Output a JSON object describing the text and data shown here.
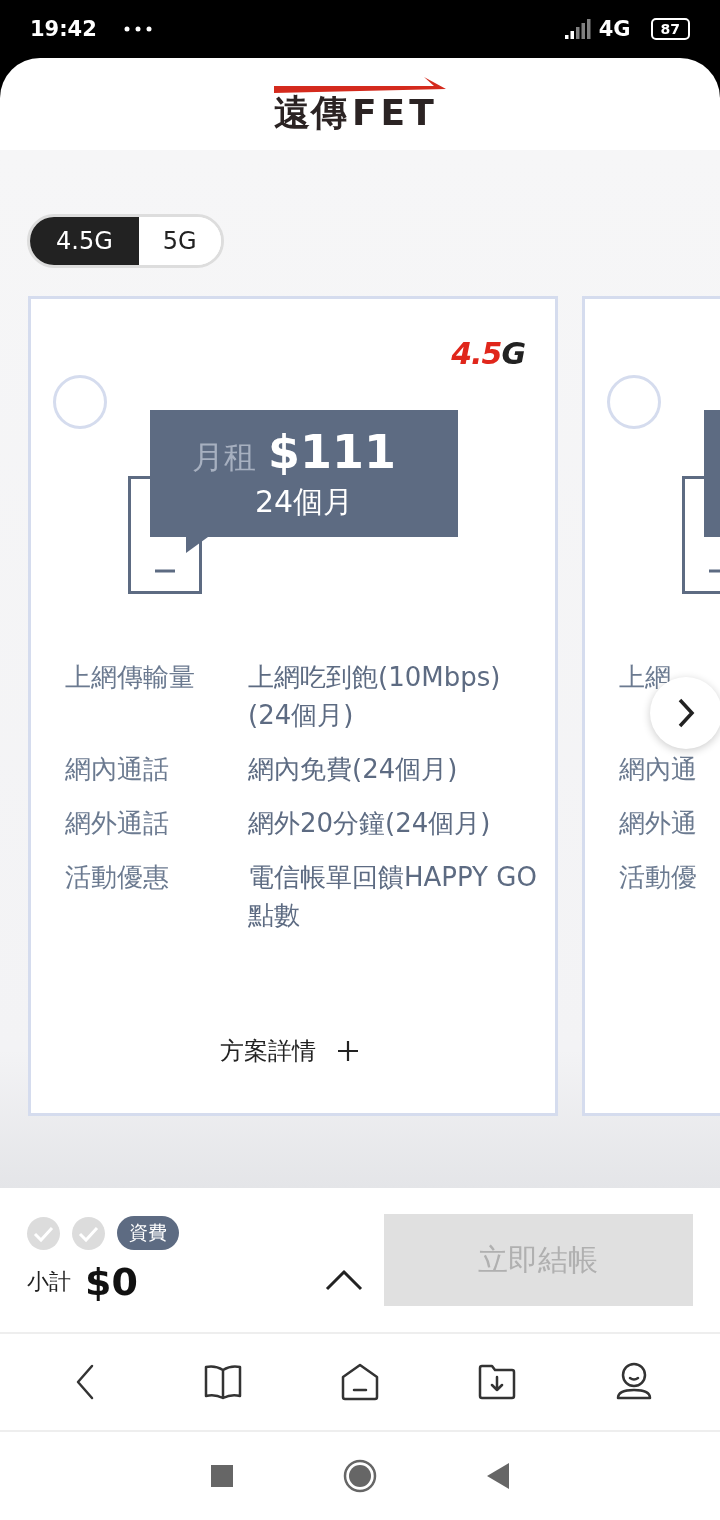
{
  "status_bar": {
    "time": "19:42",
    "network": "4G",
    "battery": "87"
  },
  "header": {
    "logo_cn": "遠傳",
    "logo_en": "FET"
  },
  "tabs": [
    {
      "label": "4.5G",
      "selected": true
    },
    {
      "label": "5G",
      "selected": false
    }
  ],
  "plans": [
    {
      "selected": false,
      "badge": {
        "main": "4.5",
        "suffix": "G"
      },
      "price_label": "月租",
      "price": "$111",
      "term": "24個月",
      "specs": [
        {
          "label": "上網傳輸量",
          "value": "上網吃到飽(10Mbps)(24個月)"
        },
        {
          "label": "網內通話",
          "value": "網內免費(24個月)"
        },
        {
          "label": "網外通話",
          "value": "網外20分鐘(24個月)"
        },
        {
          "label": "活動優惠",
          "value": "電信帳單回饋HAPPY GO 點數"
        }
      ],
      "details_link": "方案詳情"
    },
    {
      "selected": false,
      "specs": [
        {
          "label": "上網"
        },
        {
          "label": "網內通"
        },
        {
          "label": "網外通"
        },
        {
          "label": "活動優"
        }
      ]
    }
  ],
  "checkout": {
    "steps": [
      {
        "done": false
      },
      {
        "done": false
      }
    ],
    "step_label": "資費",
    "subtotal_label": "小計",
    "subtotal": "$0",
    "button": {
      "label": "立即結帳",
      "disabled": true
    }
  }
}
